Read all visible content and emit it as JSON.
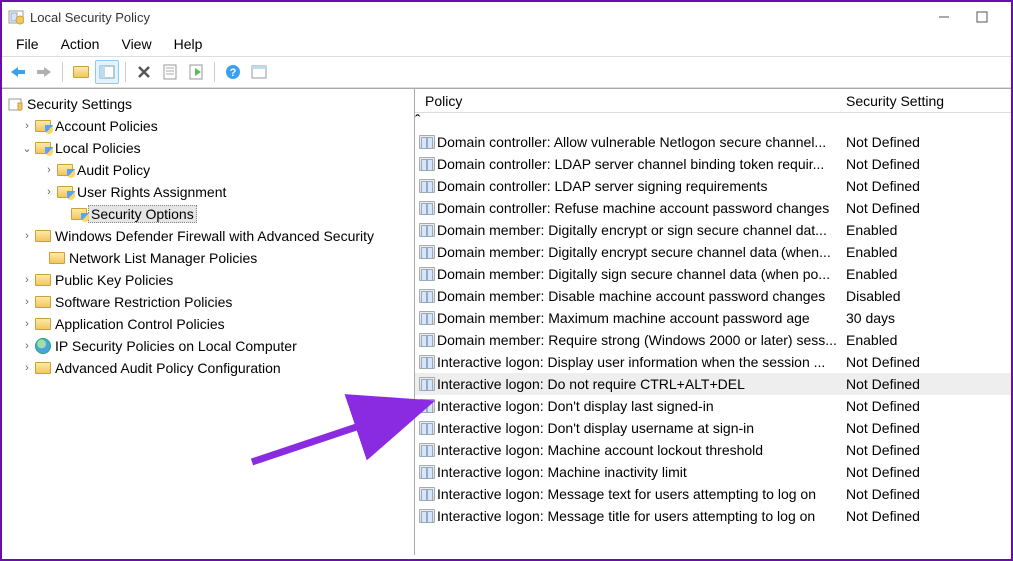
{
  "window": {
    "title": "Local Security Policy"
  },
  "menu": {
    "file": "File",
    "action": "Action",
    "view": "View",
    "help": "Help"
  },
  "tree": {
    "root": "Security Settings",
    "items": [
      {
        "exp": "›",
        "indent": 18,
        "icon": "folder-shield",
        "label": "Account Policies"
      },
      {
        "exp": "⌄",
        "indent": 18,
        "icon": "folder-shield",
        "label": "Local Policies"
      },
      {
        "exp": "›",
        "indent": 40,
        "icon": "folder-shield",
        "label": "Audit Policy"
      },
      {
        "exp": "›",
        "indent": 40,
        "icon": "folder-shield",
        "label": "User Rights Assignment"
      },
      {
        "exp": "",
        "indent": 54,
        "icon": "folder-shield",
        "label": "Security Options",
        "selected": true
      },
      {
        "exp": "›",
        "indent": 18,
        "icon": "folder",
        "label": "Windows Defender Firewall with Advanced Security"
      },
      {
        "exp": "",
        "indent": 32,
        "icon": "folder",
        "label": "Network List Manager Policies"
      },
      {
        "exp": "›",
        "indent": 18,
        "icon": "folder",
        "label": "Public Key Policies"
      },
      {
        "exp": "›",
        "indent": 18,
        "icon": "folder",
        "label": "Software Restriction Policies"
      },
      {
        "exp": "›",
        "indent": 18,
        "icon": "folder",
        "label": "Application Control Policies"
      },
      {
        "exp": "›",
        "indent": 18,
        "icon": "world",
        "label": "IP Security Policies on Local Computer"
      },
      {
        "exp": "›",
        "indent": 18,
        "icon": "folder",
        "label": "Advanced Audit Policy Configuration"
      }
    ]
  },
  "list": {
    "col_policy": "Policy",
    "col_setting": "Security Setting",
    "rows": [
      {
        "policy": "Domain controller: Allow vulnerable Netlogon secure channel...",
        "setting": "Not Defined"
      },
      {
        "policy": "Domain controller: LDAP server channel binding token requir...",
        "setting": "Not Defined"
      },
      {
        "policy": "Domain controller: LDAP server signing requirements",
        "setting": "Not Defined"
      },
      {
        "policy": "Domain controller: Refuse machine account password changes",
        "setting": "Not Defined"
      },
      {
        "policy": "Domain member: Digitally encrypt or sign secure channel dat...",
        "setting": "Enabled"
      },
      {
        "policy": "Domain member: Digitally encrypt secure channel data (when...",
        "setting": "Enabled"
      },
      {
        "policy": "Domain member: Digitally sign secure channel data (when po...",
        "setting": "Enabled"
      },
      {
        "policy": "Domain member: Disable machine account password changes",
        "setting": "Disabled"
      },
      {
        "policy": "Domain member: Maximum machine account password age",
        "setting": "30 days"
      },
      {
        "policy": "Domain member: Require strong (Windows 2000 or later) sess...",
        "setting": "Enabled"
      },
      {
        "policy": "Interactive logon: Display user information when the session ...",
        "setting": "Not Defined"
      },
      {
        "policy": "Interactive logon: Do not require CTRL+ALT+DEL",
        "setting": "Not Defined",
        "selected": true
      },
      {
        "policy": "Interactive logon: Don't display last signed-in",
        "setting": "Not Defined"
      },
      {
        "policy": "Interactive logon: Don't display username at sign-in",
        "setting": "Not Defined"
      },
      {
        "policy": "Interactive logon: Machine account lockout threshold",
        "setting": "Not Defined"
      },
      {
        "policy": "Interactive logon: Machine inactivity limit",
        "setting": "Not Defined"
      },
      {
        "policy": "Interactive logon: Message text for users attempting to log on",
        "setting": "Not Defined"
      },
      {
        "policy": "Interactive logon: Message title for users attempting to log on",
        "setting": "Not Defined"
      }
    ]
  }
}
